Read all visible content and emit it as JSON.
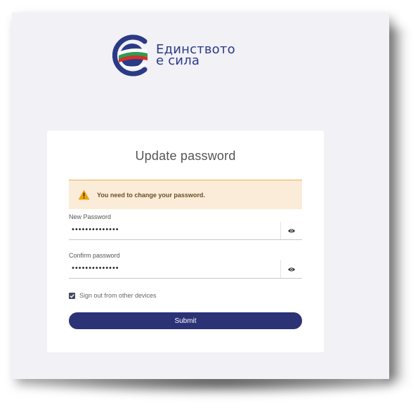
{
  "brand": {
    "line1": "Единството",
    "line2": "е сила",
    "logo_icon": "flag-globe-icon",
    "colors": {
      "brand_blue": "#2b3a86",
      "flag_white": "#ffffff",
      "flag_green": "#2e9e4f",
      "flag_red": "#d6312b"
    }
  },
  "form": {
    "title": "Update password",
    "alert": {
      "icon": "warning-icon",
      "text": "You need to change your password."
    },
    "new_password": {
      "label": "New Password",
      "value": "••••••••••••••",
      "toggle_icon": "eye-icon"
    },
    "confirm_password": {
      "label": "Confirm password",
      "value": "••••••••••••••",
      "toggle_icon": "eye-icon"
    },
    "sign_out_other_devices": {
      "label": "Sign out from other devices",
      "checked": true
    },
    "submit_label": "Submit",
    "colors": {
      "submit_bg": "#2c3276",
      "alert_bg": "#fbecd9",
      "alert_border": "#f0ad4e"
    }
  }
}
